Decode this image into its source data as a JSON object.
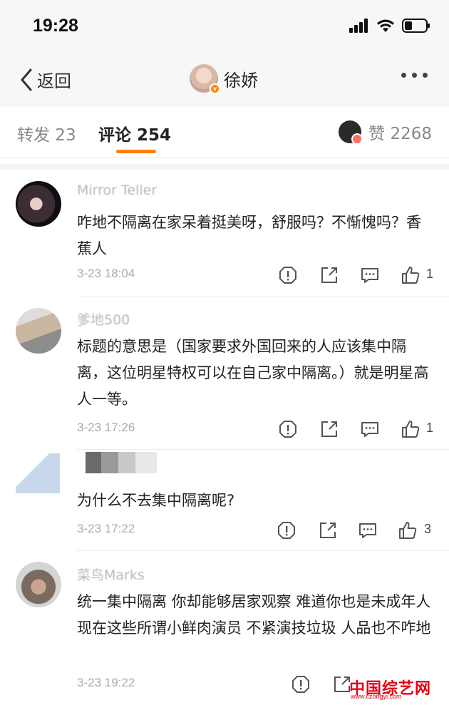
{
  "status_bar": {
    "time": "19:28"
  },
  "nav": {
    "back_label": "返回",
    "title": "徐娇",
    "verified_badge": "v"
  },
  "tabs": {
    "repost": "转发 23",
    "comment": "评论 254",
    "like": "赞 2268"
  },
  "comments": [
    {
      "username": "Mirror Teller",
      "text": "咋地不隔离在家呆着挺美呀，舒服吗？不惭愧吗？香蕉人",
      "time": "3-23 18:04",
      "likes": "1"
    },
    {
      "username": "爹地500",
      "text": "标题的意思是（国家要求外国回来的人应该集中隔离，这位明星特权可以在自己家中隔离。）就是明星高人一等。",
      "time": "3-23 17:26",
      "likes": "1"
    },
    {
      "username": "",
      "text": "为什么不去集中隔离呢?",
      "time": "3-23 17:22",
      "likes": "3"
    },
    {
      "username": "菜鸟Marks",
      "text": "统一集中隔离 你却能够居家观察 难道你也是未成年人 现在这些所谓小鲜肉演员 不紧演技垃圾 人品也不咋地",
      "time": "3-23 19:22",
      "likes": ""
    }
  ],
  "watermark": {
    "text": "中国综艺网",
    "url": "www.czongyi.com"
  },
  "colors": {
    "accent": "#ff8200",
    "watermark": "#e60012"
  },
  "icons": {
    "back": "chevron-left-icon",
    "more": "more-dots-icon",
    "report": "report-icon",
    "share": "share-icon",
    "reply": "comment-icon",
    "like": "thumbs-up-icon"
  }
}
